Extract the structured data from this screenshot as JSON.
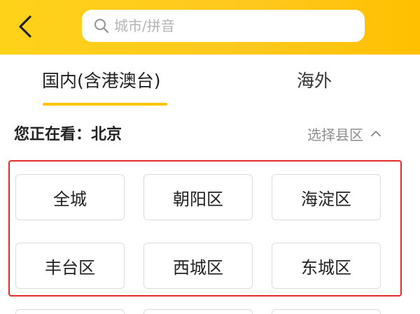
{
  "header": {
    "back_icon": "chevron-left-icon",
    "search": {
      "icon": "search-icon",
      "placeholder": "城市/拼音",
      "value": ""
    },
    "colors": {
      "start": "#ffd21a",
      "end": "#ffc000"
    }
  },
  "tabs": [
    {
      "label": "国内(含港澳台)",
      "active": true
    },
    {
      "label": "海外",
      "active": false
    }
  ],
  "current": {
    "label": "您正在看：",
    "city": "北京",
    "select_district_label": "选择县区",
    "select_icon": "chevron-up-icon"
  },
  "districts": [
    {
      "label": "全城"
    },
    {
      "label": "朝阳区"
    },
    {
      "label": "海淀区"
    },
    {
      "label": "丰台区"
    },
    {
      "label": "西城区"
    },
    {
      "label": "东城区"
    }
  ],
  "colors": {
    "accent": "#ffc300",
    "highlight": "#e52c2c",
    "border": "#dcdcdc"
  }
}
